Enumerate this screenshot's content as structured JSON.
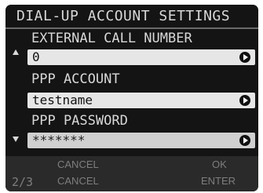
{
  "title": "DIAL-UP ACCOUNT SETTINGS",
  "fields": [
    {
      "label": "EXTERNAL CALL NUMBER",
      "value": "0"
    },
    {
      "label": "PPP ACCOUNT",
      "value": "testname"
    },
    {
      "label": "PPP PASSWORD",
      "value": "*******"
    }
  ],
  "footer": {
    "page": "2/3",
    "left_top": "CANCEL",
    "left_bottom": "CANCEL",
    "right_top": "OK",
    "right_bottom": "ENTER"
  },
  "icons": {
    "scroll_up": "triangle-up-icon",
    "scroll_down": "triangle-down-icon",
    "field_action": "circle-arrow-right-icon"
  },
  "colors": {
    "screen_bg": "#141414",
    "text": "#d8d8d8",
    "field_bg": "#e6e6e6",
    "footer_bg": "#2a2a2a",
    "footer_text": "#7e7e7e"
  }
}
